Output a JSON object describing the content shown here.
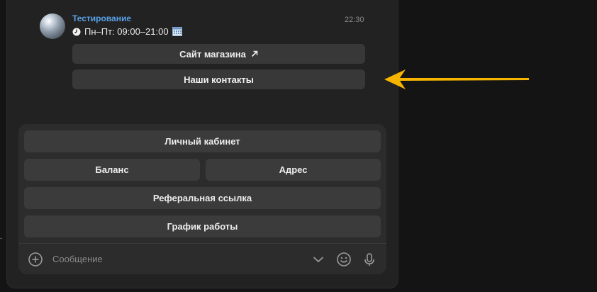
{
  "message": {
    "sender": "Тестирование",
    "time": "22:30",
    "text": "Пн–Пт: 09:00–21:00",
    "clock_icon": "clock-icon",
    "calendar_icon": "calendar-icon"
  },
  "inline_buttons": [
    {
      "label": "Сайт магазина",
      "icon": "external-link-icon"
    },
    {
      "label": "Наши контакты"
    }
  ],
  "keyboard": {
    "row1": "Личный кабинет",
    "row2_left": "Баланс",
    "row2_right": "Адрес",
    "row3": "Реферальная ссылка",
    "row4": "График работы"
  },
  "composer": {
    "placeholder": "Сообщение",
    "icons": [
      "add-icon",
      "chevron-down-icon",
      "emoji-icon",
      "microphone-icon"
    ]
  },
  "annotation": {
    "arrow_color": "#f5b400"
  },
  "colors": {
    "sender": "#5aa2e8",
    "background": "#141414",
    "panel": "#222222",
    "button": "#383838"
  }
}
